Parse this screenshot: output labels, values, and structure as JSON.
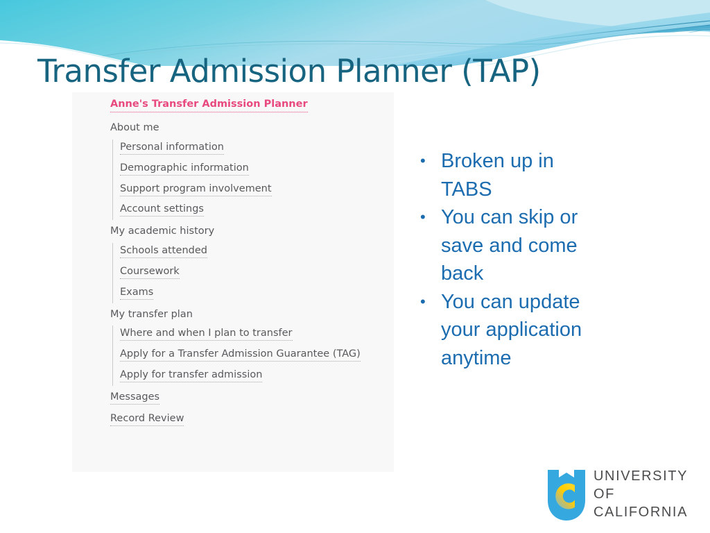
{
  "slide": {
    "title": "Transfer Admission Planner (TAP)",
    "title_color": "#176481",
    "background_color": "#ffffff"
  },
  "banner": {
    "name": "wave-banner",
    "colors": {
      "wave_cyan": "#3fc5de",
      "wave_light_blue": "#9ad9ea",
      "wave_teal": "#35b7c9",
      "wave_pale": "#c7eaf3",
      "wave_blue": "#5cb8e0"
    }
  },
  "tap_screenshot": {
    "heading": "Anne's Transfer Admission Planner",
    "heading_color": "#e8497f",
    "background_color": "#f8f8f8",
    "nav": [
      {
        "type": "section",
        "label": "About me",
        "children": [
          "Personal information",
          "Demographic information",
          "Support program involvement",
          "Account settings"
        ]
      },
      {
        "type": "section",
        "label": "My academic history",
        "children": [
          "Schools attended",
          "Coursework",
          "Exams"
        ]
      },
      {
        "type": "section",
        "label": "My transfer plan",
        "children": [
          "Where and when I plan to transfer",
          "Apply for a Transfer Admission Guarantee (TAG)",
          "Apply for transfer admission"
        ]
      },
      {
        "type": "top",
        "label": "Messages",
        "children": []
      },
      {
        "type": "top",
        "label": "Record Review",
        "children": []
      }
    ]
  },
  "bullets": {
    "color": "#1c6cb0",
    "items": [
      "Broken up in TABS",
      "You can skip or save and come back",
      "You can update your application anytime"
    ]
  },
  "logo": {
    "name": "university-of-california-logo",
    "lines": [
      "UNIVERSITY",
      "OF",
      "CALIFORNIA"
    ],
    "shield_color": "#35a8e0",
    "c_color": "#ffcd00",
    "text_color": "#4d4d4f"
  }
}
